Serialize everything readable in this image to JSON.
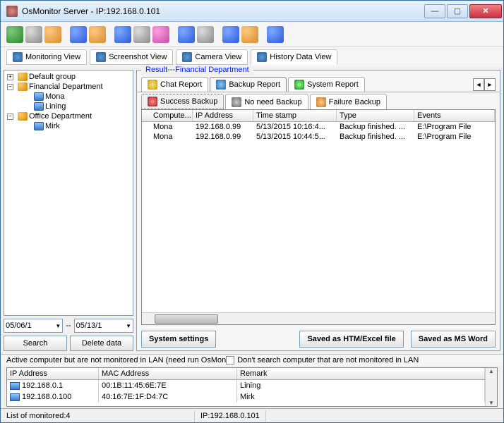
{
  "title": "OsMonitor Server -   IP:192.168.0.101",
  "viewtabs": {
    "monitoring": "Monitoring View",
    "screenshot": "Screenshot View",
    "camera": "Camera View",
    "history": "History Data View"
  },
  "tree": {
    "default_group": "Default group",
    "financial": "Financial Department",
    "mona": "Mona",
    "lining": "Lining",
    "office": "Office Department",
    "mirk": "Mirk"
  },
  "dates": {
    "from": "05/06/1",
    "sep": "--",
    "to": "05/13/1"
  },
  "buttons": {
    "search": "Search",
    "delete": "Delete data"
  },
  "result_title": "Result---Financial Department",
  "report_tabs": {
    "chat": "Chat Report",
    "backup": "Backup Report",
    "system": "System Report"
  },
  "sub_tabs": {
    "success": "Success Backup",
    "noneed": "No need Backup",
    "failure": "Failure Backup"
  },
  "grid": {
    "cols": {
      "c0": "Compute...",
      "c1": "IP Address",
      "c2": "Time stamp",
      "c3": "Type",
      "c4": "Events"
    },
    "rows": [
      {
        "c0": "Mona",
        "c1": "192.168.0.99",
        "c2": "5/13/2015 10:16:4...",
        "c3": "Backup finished. ...",
        "c4": "E:\\Program File"
      },
      {
        "c0": "Mona",
        "c1": "192.168.0.99",
        "c2": "5/13/2015 10:44:5...",
        "c3": "Backup finished. ...",
        "c4": "E:\\Program File"
      }
    ]
  },
  "bottom": {
    "settings": "System settings",
    "htm": "Saved as HTM/Excel file",
    "word": "Saved as MS Word"
  },
  "msg": {
    "text": "Active computer but are not monitored in LAN (need run OsMon",
    "checkbox": "Don't search computer that are not monitored in LAN"
  },
  "lan": {
    "cols": {
      "ip": "IP Address",
      "mac": "MAC Address",
      "remark": "Remark"
    },
    "rows": [
      {
        "ip": "192.168.0.1",
        "mac": "00:1B:11:45:6E:7E",
        "remark": "Lining"
      },
      {
        "ip": "192.168.0.100",
        "mac": "40:16:7E:1F:D4:7C",
        "remark": "Mirk"
      }
    ]
  },
  "status": {
    "left": "List of monitored:4",
    "right": "IP:192.168.0.101"
  }
}
